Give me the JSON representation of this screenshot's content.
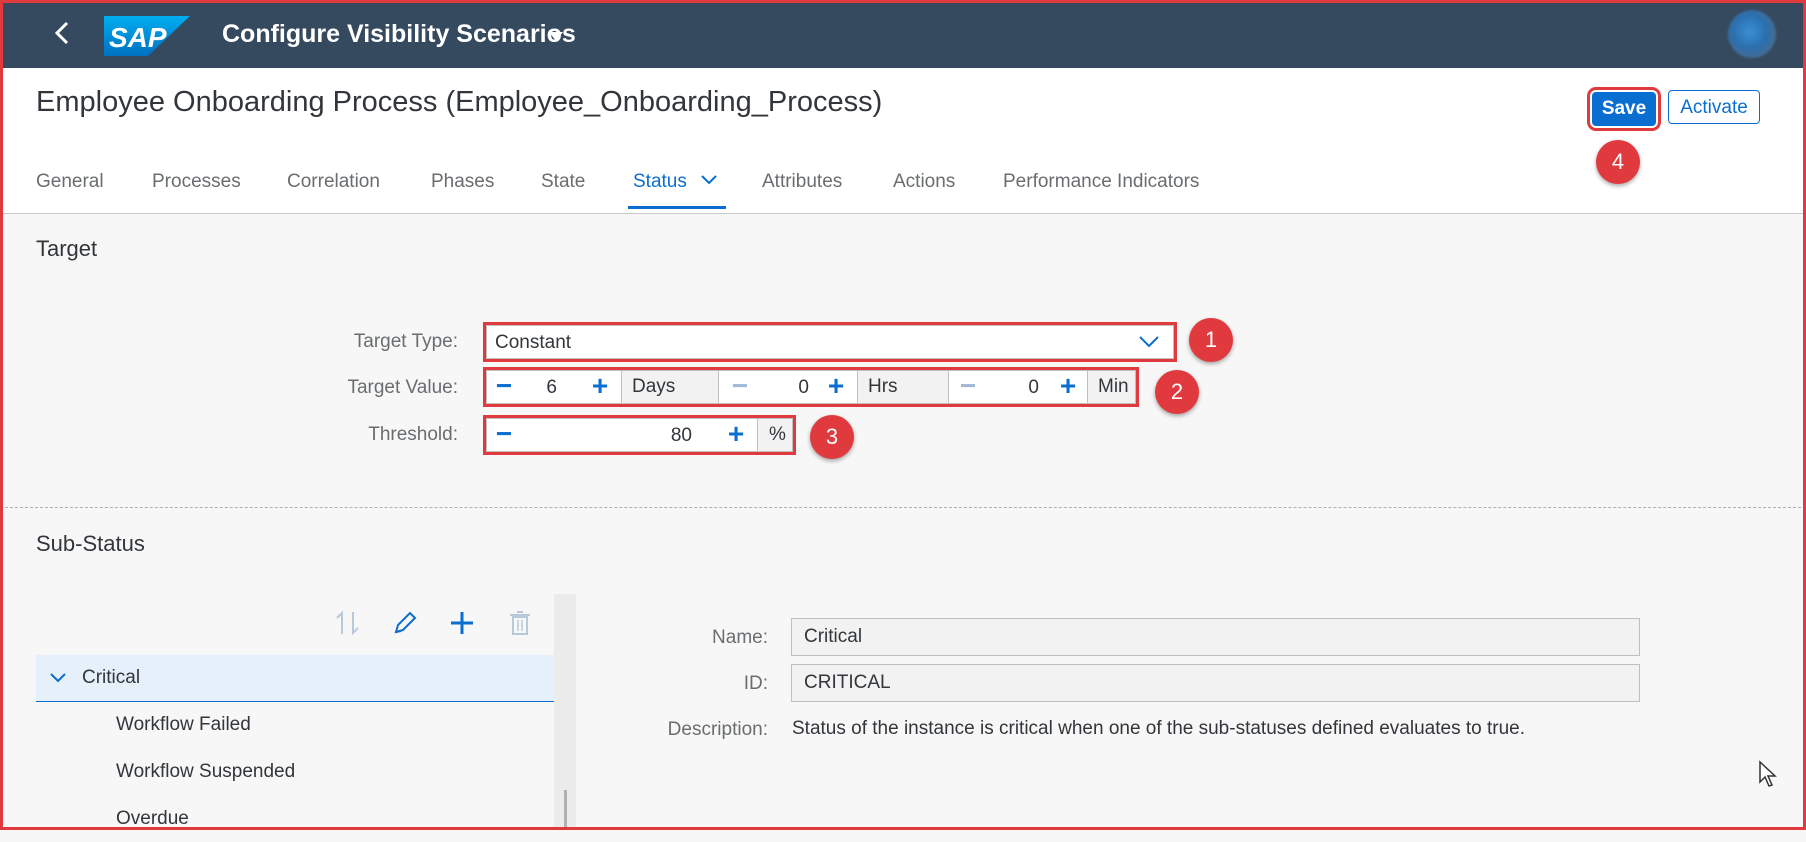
{
  "shell": {
    "title": "Configure Visibility Scenarios",
    "logo_text": "SAP"
  },
  "header": {
    "object_title": "Employee Onboarding Process (Employee_Onboarding_Process)",
    "save_label": "Save",
    "activate_label": "Activate"
  },
  "tabs": [
    {
      "label": "General"
    },
    {
      "label": "Processes"
    },
    {
      "label": "Correlation"
    },
    {
      "label": "Phases"
    },
    {
      "label": "State"
    },
    {
      "label": "Status",
      "active": true
    },
    {
      "label": "Attributes"
    },
    {
      "label": "Actions"
    },
    {
      "label": "Performance Indicators"
    }
  ],
  "target": {
    "section_title": "Target",
    "type_label": "Target Type:",
    "type_value": "Constant",
    "value_label": "Target Value:",
    "days": "6",
    "days_unit": "Days",
    "hrs": "0",
    "hrs_unit": "Hrs",
    "min": "0",
    "min_unit": "Min",
    "threshold_label": "Threshold:",
    "threshold": "80",
    "threshold_unit": "%"
  },
  "substatus": {
    "section_title": "Sub-Status",
    "tree": {
      "root": "Critical",
      "children": [
        "Workflow Failed",
        "Workflow Suspended",
        "Overdue"
      ]
    },
    "detail": {
      "name_label": "Name:",
      "name_value": "Critical",
      "id_label": "ID:",
      "id_value": "CRITICAL",
      "description_label": "Description:",
      "description_value": "Status of the instance is critical when one of the sub-statuses defined evaluates to true."
    }
  },
  "annotations": [
    "1",
    "2",
    "3",
    "4"
  ],
  "colors": {
    "shell": "#354a5f",
    "accent": "#0a6ed1",
    "annotation": "#e03a3e"
  },
  "icons": [
    "back-icon",
    "sap-logo",
    "sort-icon",
    "edit-icon",
    "add-icon",
    "delete-icon",
    "chevron-down-icon",
    "cursor-icon"
  ]
}
